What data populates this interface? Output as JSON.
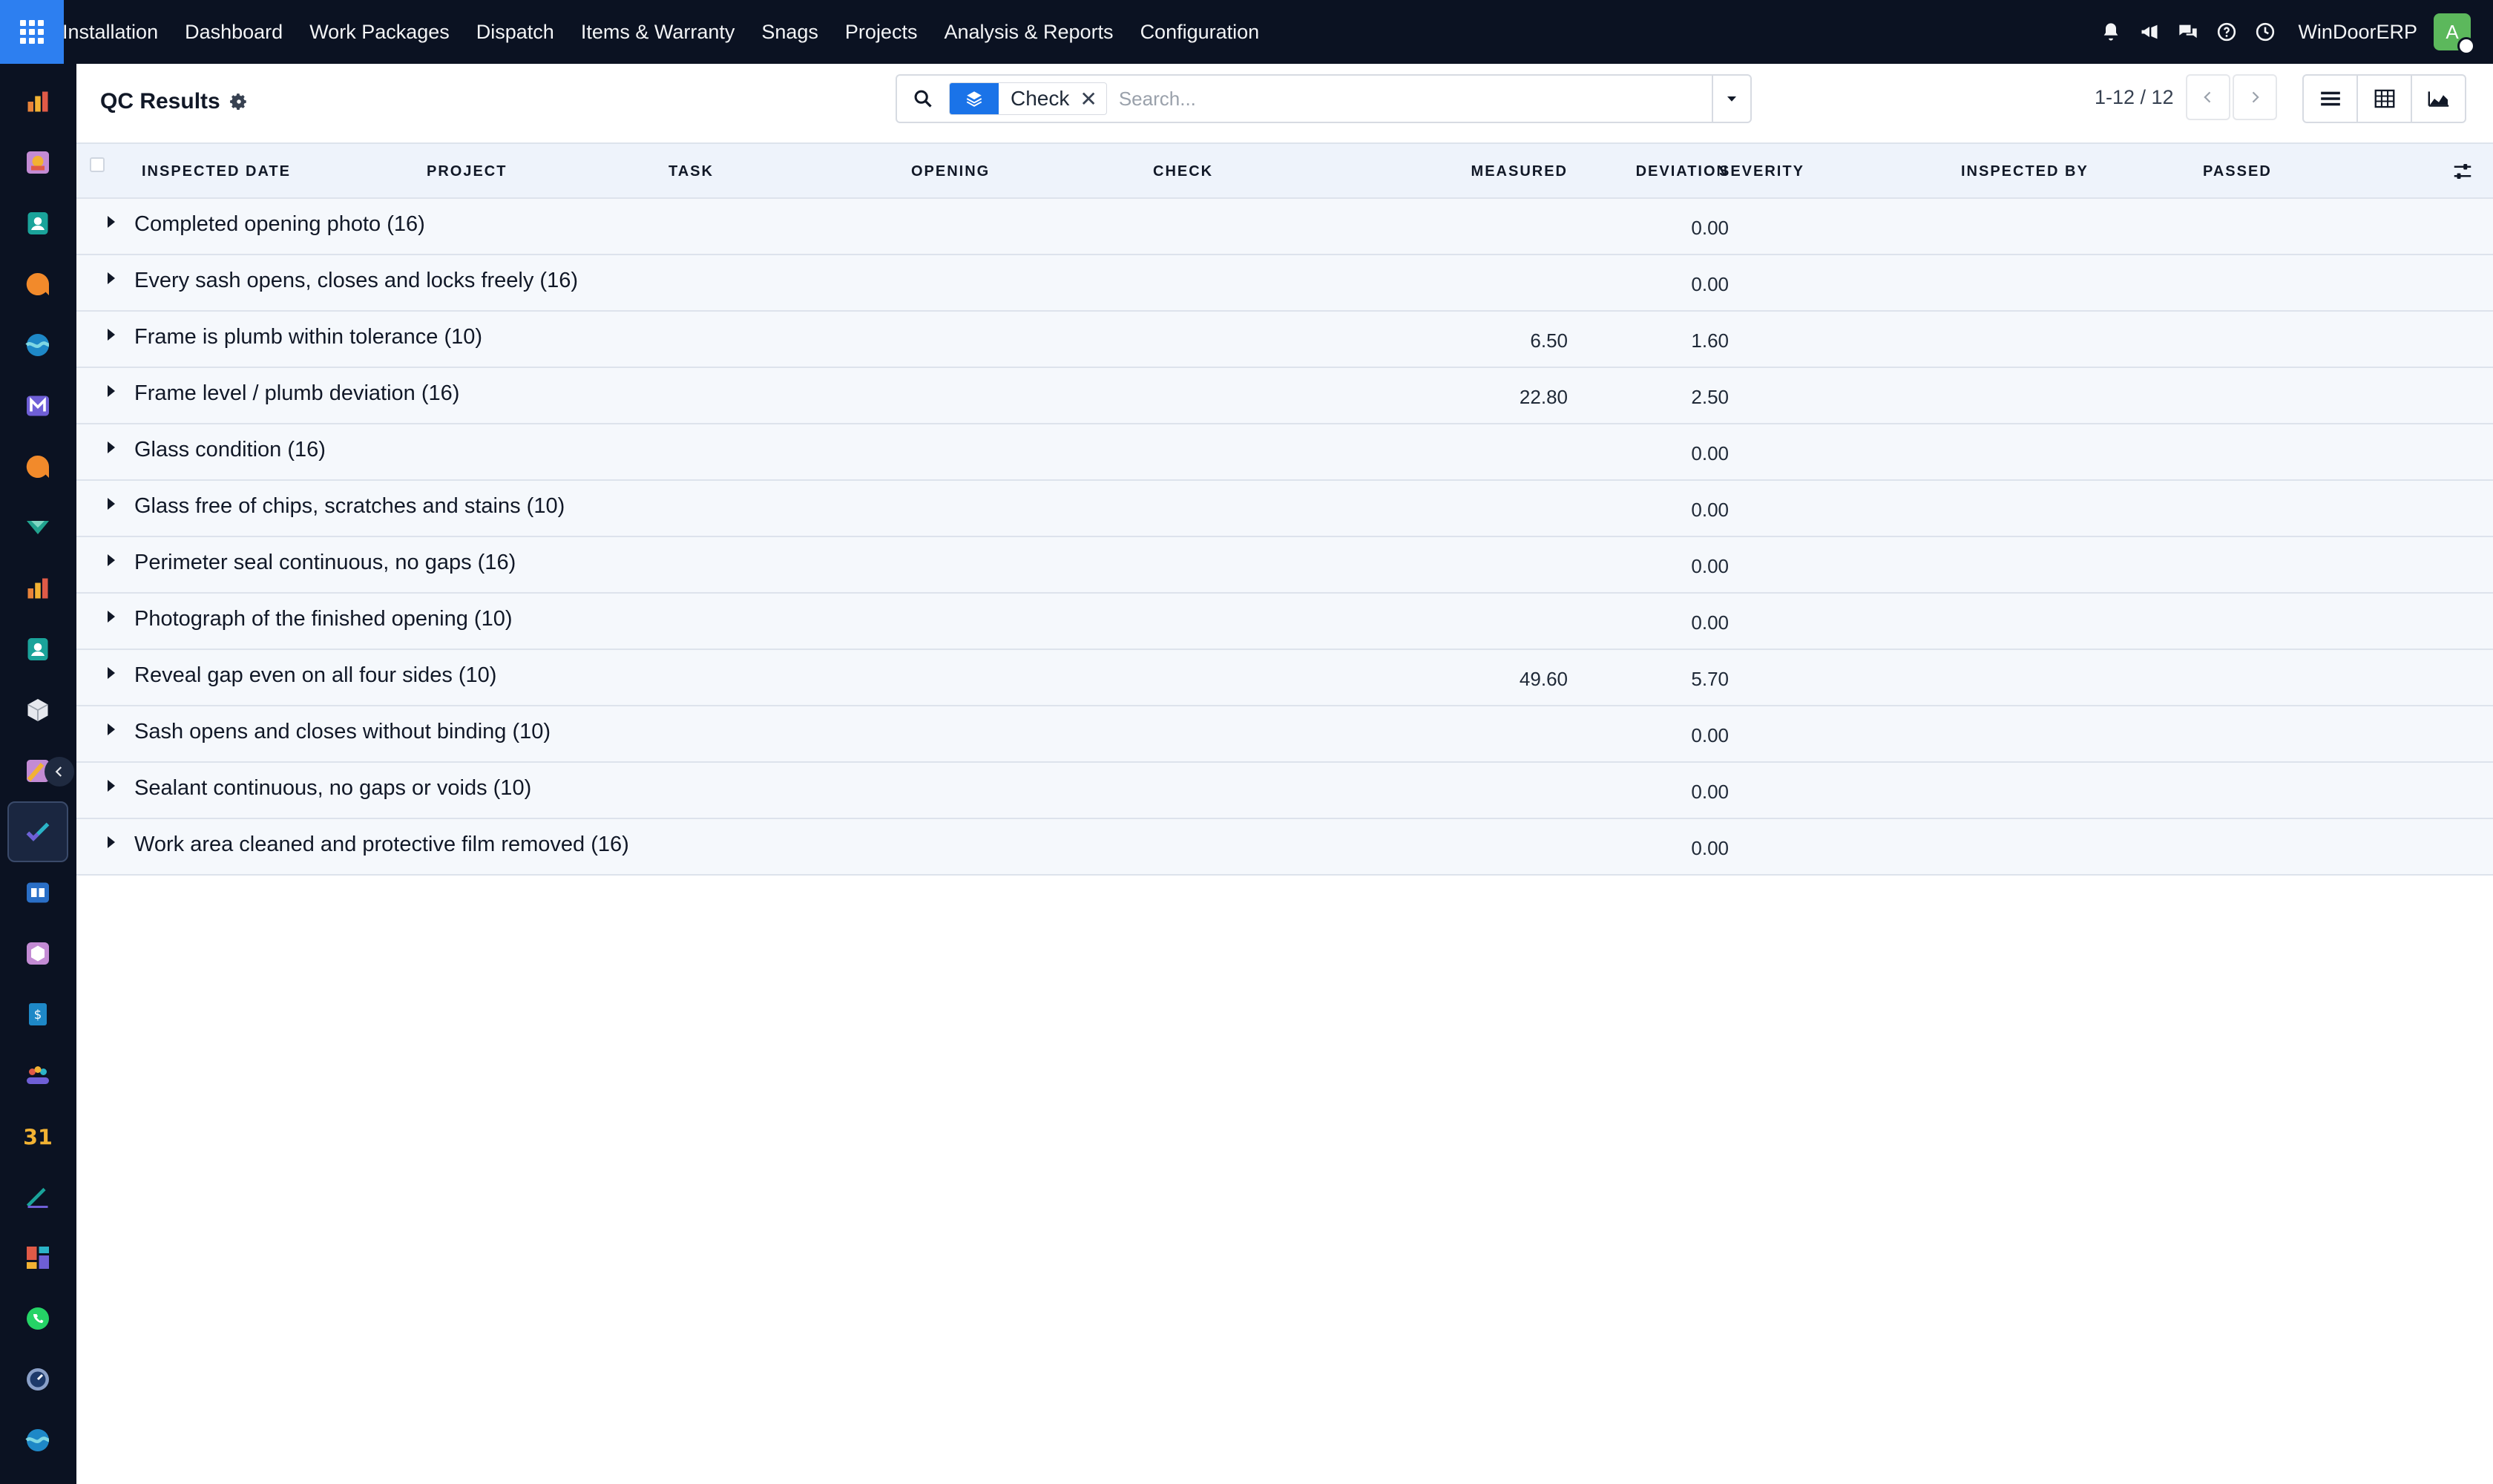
{
  "navbar": {
    "brand": "Installation",
    "menu": [
      "Dashboard",
      "Work Packages",
      "Dispatch",
      "Items & Warranty",
      "Snags",
      "Projects",
      "Analysis & Reports",
      "Configuration"
    ],
    "company": "WinDoorERP",
    "avatar_initial": "A",
    "icons": [
      "bell-icon",
      "megaphone-icon",
      "chat-icon",
      "help-icon",
      "clock-icon"
    ]
  },
  "sidebar": {
    "apps": [
      "sales-app",
      "gallery-app",
      "contacts-app",
      "discuss-app",
      "planning-app",
      "email-marketing-app",
      "livechat-app",
      "documents-app",
      "reports-app",
      "employees-app",
      "inventory-app",
      "crm-app",
      "quality-app",
      "knowledge-app",
      "products-app",
      "invoicing-app",
      "team-app",
      "calendar-app",
      "sign-app",
      "dashboards-app",
      "whatsapp-app",
      "timer-app",
      "website-app"
    ],
    "active_index": 12
  },
  "control": {
    "title": "QC Results",
    "search_facet": "Check",
    "search_placeholder": "Search...",
    "pager": "1-12 / 12"
  },
  "table": {
    "columns": [
      "INSPECTED DATE",
      "PROJECT",
      "TASK",
      "OPENING",
      "CHECK",
      "MEASURED",
      "DEVIATION",
      "SEVERITY",
      "INSPECTED BY",
      "PASSED"
    ],
    "groups": [
      {
        "label": "Completed opening photo (16)",
        "measured": "",
        "deviation": "0.00"
      },
      {
        "label": "Every sash opens, closes and locks freely (16)",
        "measured": "",
        "deviation": "0.00"
      },
      {
        "label": "Frame is plumb within tolerance (10)",
        "measured": "6.50",
        "deviation": "1.60"
      },
      {
        "label": "Frame level / plumb deviation (16)",
        "measured": "22.80",
        "deviation": "2.50"
      },
      {
        "label": "Glass condition (16)",
        "measured": "",
        "deviation": "0.00"
      },
      {
        "label": "Glass free of chips, scratches and stains (10)",
        "measured": "",
        "deviation": "0.00"
      },
      {
        "label": "Perimeter seal continuous, no gaps (16)",
        "measured": "",
        "deviation": "0.00"
      },
      {
        "label": "Photograph of the finished opening (10)",
        "measured": "",
        "deviation": "0.00"
      },
      {
        "label": "Reveal gap even on all four sides (10)",
        "measured": "49.60",
        "deviation": "5.70"
      },
      {
        "label": "Sash opens and closes without binding (10)",
        "measured": "",
        "deviation": "0.00"
      },
      {
        "label": "Sealant continuous, no gaps or voids (10)",
        "measured": "",
        "deviation": "0.00"
      },
      {
        "label": "Work area cleaned and protective film removed (16)",
        "measured": "",
        "deviation": "0.00"
      }
    ]
  },
  "colors": {
    "navbar_bg": "#0b1222",
    "accent": "#1a73e8",
    "avatar_bg": "#5cb85c",
    "header_bg": "#eef3fb",
    "row_bg": "#f5f8fc"
  }
}
